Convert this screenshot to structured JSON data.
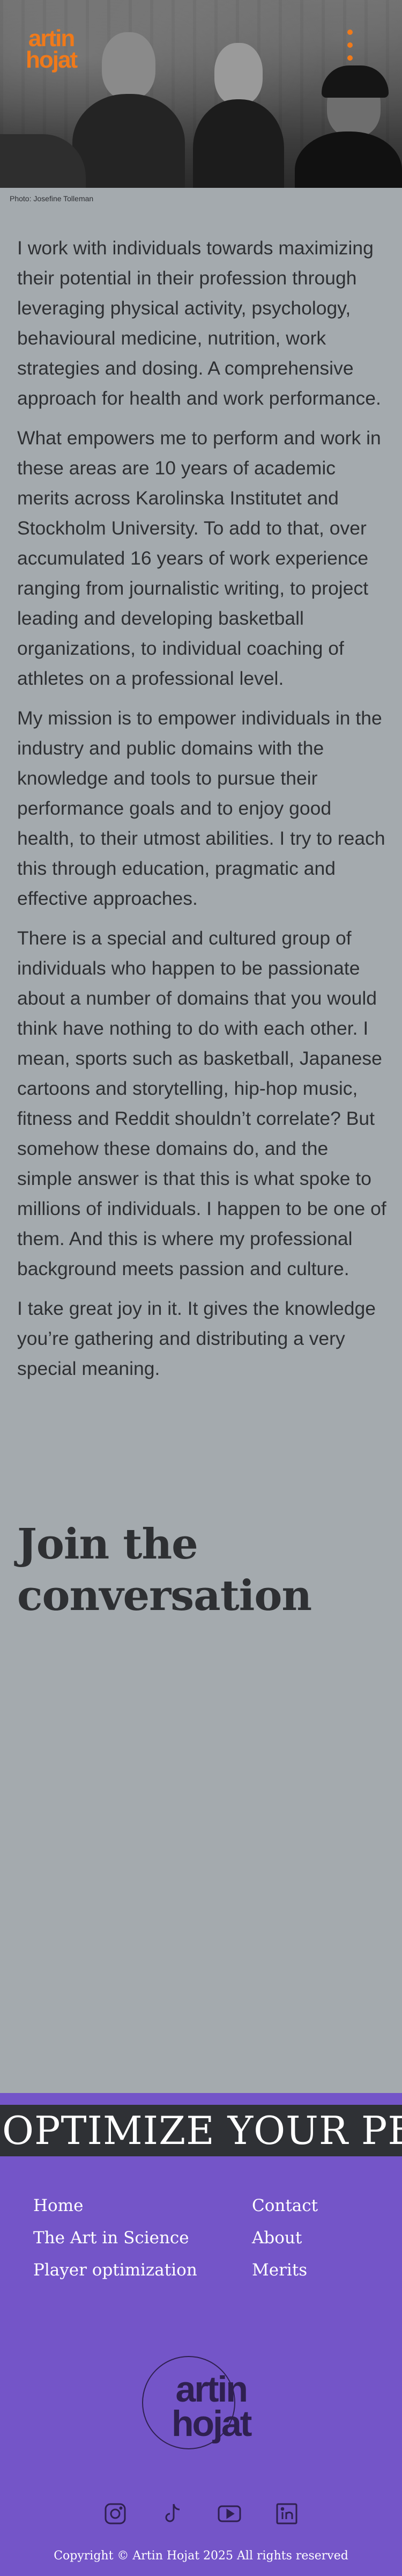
{
  "header": {
    "logo_line1": "artin",
    "logo_line2": "hojat",
    "menu_icon": "menu-dots-icon",
    "accent_color": "#f07a1a"
  },
  "hero": {
    "photo_credit": "Photo: Josefine Tolleman"
  },
  "main": {
    "paragraphs": [
      "I work with individuals towards maximizing their potential in their profession through leveraging physical activity, psychology, behavioural medicine, nutrition, work strategies and dosing. A comprehensive approach for health and work performance.",
      "What empowers me to perform and work in these areas are 10 years of academic merits across Karolinska Institutet and Stockholm University. To add to that, over accumulated 16 years of work experience ranging from journalistic writing, to project leading and developing basketball organizations, to individual coaching of athletes on a professional level.",
      "My mission is to empower individuals in the industry and public domains with the knowledge and tools to pursue their performance goals and to enjoy good health, to their utmost abilities. I try to reach this through education, pragmatic and effective approaches.",
      "There is a special and cultured group of individuals who happen to be passionate about a number of domains that you would think have nothing to do with each other. I mean, sports such as basketball, Japanese cartoons and storytelling, hip-hop music, fitness and Reddit shouldn’t correlate? But somehow these domains do, and the simple answer is that this is what spoke to millions of individuals. I happen to be one of them. And this is where my professional background meets passion and culture.",
      "I take great joy in it. It gives the knowledge you’re gathering and distributing a very special meaning."
    ],
    "join_heading": "Join the conversation"
  },
  "marquee": {
    "text": "OPTIMIZE YOUR PERFORMANCE"
  },
  "footer": {
    "nav_left": [
      "Home",
      "The Art in Science",
      "Player optimization"
    ],
    "nav_right": [
      "Contact",
      "About",
      "Merits"
    ],
    "logo_line1": "artin",
    "logo_line2": "hojat",
    "social_icons": [
      "instagram-icon",
      "tiktok-icon",
      "youtube-icon",
      "linkedin-icon"
    ],
    "copyright": "Copyright © Artin Hojat 2025 All rights reserved",
    "background_color": "#7455c8"
  }
}
